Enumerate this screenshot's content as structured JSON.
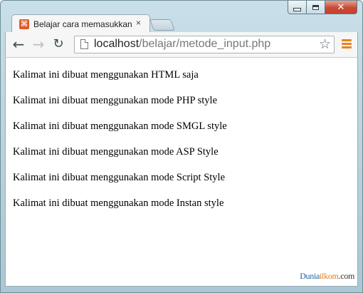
{
  "window": {
    "controls": {
      "minimize_icon": "minimize-icon",
      "maximize_icon": "maximize-icon",
      "close_glyph": "✕"
    }
  },
  "tab": {
    "favicon_glyph": "⌘",
    "title": "Belajar cara memasukkan",
    "close_glyph": "×"
  },
  "toolbar": {
    "back_glyph": "←",
    "forward_glyph": "→",
    "reload_glyph": "↻",
    "url_host": "localhost",
    "url_path": "/belajar/metode_input.php",
    "star_glyph": "☆",
    "accent_color": "#e8831e"
  },
  "content": {
    "lines": [
      "Kalimat ini dibuat menggunakan HTML saja",
      "Kalimat ini dibuat menggunakan mode PHP style",
      "Kalimat ini dibuat menggunakan mode SMGL style",
      "Kalimat ini dibuat menggunakan mode ASP Style",
      "Kalimat ini dibuat menggunakan mode Script Style",
      "Kalimat ini dibuat menggunakan mode Instan style"
    ],
    "watermark": {
      "part1": "Dunia",
      "part2": "ilkom",
      "part3": ".com"
    }
  }
}
